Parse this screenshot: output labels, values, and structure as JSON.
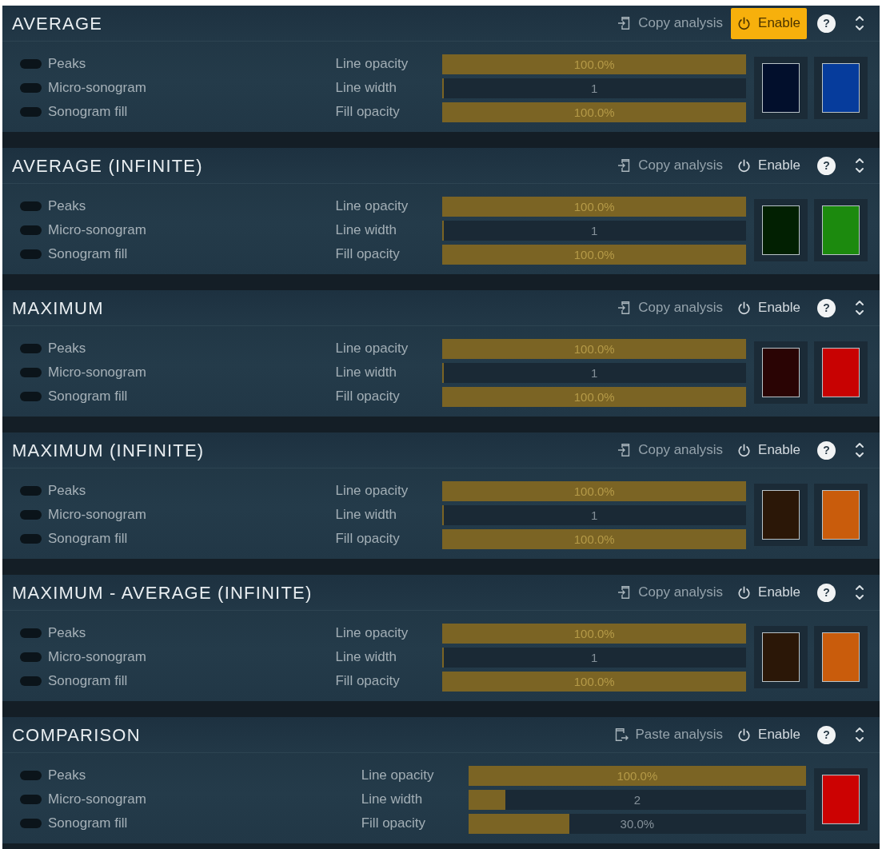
{
  "sections": [
    {
      "title": "AVERAGE",
      "analysis_button": {
        "kind": "copy",
        "label": "Copy analysis"
      },
      "enable": {
        "label": "Enable",
        "on": true
      },
      "help": "?",
      "toggles": [
        {
          "label": "Peaks",
          "on": false
        },
        {
          "label": "Micro-sonogram",
          "on": false
        },
        {
          "label": "Sonogram fill",
          "on": false
        }
      ],
      "sliders": [
        {
          "label": "Line opacity",
          "value": "100.0%",
          "level": 1
        },
        {
          "label": "Line width",
          "value": "1",
          "level": 0
        },
        {
          "label": "Fill opacity",
          "value": "100.0%",
          "level": 1
        }
      ],
      "swatches": [
        {
          "color": "#020f2c"
        },
        {
          "color": "#063c9c"
        }
      ]
    },
    {
      "title": "AVERAGE (INFINITE)",
      "analysis_button": {
        "kind": "copy",
        "label": "Copy analysis"
      },
      "enable": {
        "label": "Enable",
        "on": false
      },
      "help": "?",
      "toggles": [
        {
          "label": "Peaks",
          "on": false
        },
        {
          "label": "Micro-sonogram",
          "on": false
        },
        {
          "label": "Sonogram fill",
          "on": false
        }
      ],
      "sliders": [
        {
          "label": "Line opacity",
          "value": "100.0%",
          "level": 1
        },
        {
          "label": "Line width",
          "value": "1",
          "level": 0
        },
        {
          "label": "Fill opacity",
          "value": "100.0%",
          "level": 1
        }
      ],
      "swatches": [
        {
          "color": "#022002"
        },
        {
          "color": "#1c8a0e"
        }
      ]
    },
    {
      "title": "MAXIMUM",
      "analysis_button": {
        "kind": "copy",
        "label": "Copy analysis"
      },
      "enable": {
        "label": "Enable",
        "on": false
      },
      "help": "?",
      "toggles": [
        {
          "label": "Peaks",
          "on": false
        },
        {
          "label": "Micro-sonogram",
          "on": false
        },
        {
          "label": "Sonogram fill",
          "on": false
        }
      ],
      "sliders": [
        {
          "label": "Line opacity",
          "value": "100.0%",
          "level": 1
        },
        {
          "label": "Line width",
          "value": "1",
          "level": 0
        },
        {
          "label": "Fill opacity",
          "value": "100.0%",
          "level": 1
        }
      ],
      "swatches": [
        {
          "color": "#2a0404"
        },
        {
          "color": "#c80202"
        }
      ]
    },
    {
      "title": "MAXIMUM (INFINITE)",
      "analysis_button": {
        "kind": "copy",
        "label": "Copy analysis"
      },
      "enable": {
        "label": "Enable",
        "on": false
      },
      "help": "?",
      "toggles": [
        {
          "label": "Peaks",
          "on": false
        },
        {
          "label": "Micro-sonogram",
          "on": false
        },
        {
          "label": "Sonogram fill",
          "on": false
        }
      ],
      "sliders": [
        {
          "label": "Line opacity",
          "value": "100.0%",
          "level": 1
        },
        {
          "label": "Line width",
          "value": "1",
          "level": 0
        },
        {
          "label": "Fill opacity",
          "value": "100.0%",
          "level": 1
        }
      ],
      "swatches": [
        {
          "color": "#2b1707"
        },
        {
          "color": "#c95c0c"
        }
      ]
    },
    {
      "title": "MAXIMUM - AVERAGE (INFINITE)",
      "analysis_button": {
        "kind": "copy",
        "label": "Copy analysis"
      },
      "enable": {
        "label": "Enable",
        "on": false
      },
      "help": "?",
      "toggles": [
        {
          "label": "Peaks",
          "on": false
        },
        {
          "label": "Micro-sonogram",
          "on": false
        },
        {
          "label": "Sonogram fill",
          "on": false
        }
      ],
      "sliders": [
        {
          "label": "Line opacity",
          "value": "100.0%",
          "level": 1
        },
        {
          "label": "Line width",
          "value": "1",
          "level": 0
        },
        {
          "label": "Fill opacity",
          "value": "100.0%",
          "level": 1
        }
      ],
      "swatches": [
        {
          "color": "#2b1707"
        },
        {
          "color": "#c95c0c"
        }
      ]
    },
    {
      "title": "COMPARISON",
      "analysis_button": {
        "kind": "paste",
        "label": "Paste analysis"
      },
      "enable": {
        "label": "Enable",
        "on": false
      },
      "help": "?",
      "toggles": [
        {
          "label": "Peaks",
          "on": false
        },
        {
          "label": "Micro-sonogram",
          "on": false
        },
        {
          "label": "Sonogram fill",
          "on": false
        }
      ],
      "sliders": [
        {
          "label": "Line opacity",
          "value": "100.0%",
          "level": 1
        },
        {
          "label": "Line width",
          "value": "2",
          "level": 0.11
        },
        {
          "label": "Fill opacity",
          "value": "30.0%",
          "level": 0.3
        }
      ],
      "swatches": [
        {
          "color": "#cc0202"
        }
      ]
    }
  ]
}
